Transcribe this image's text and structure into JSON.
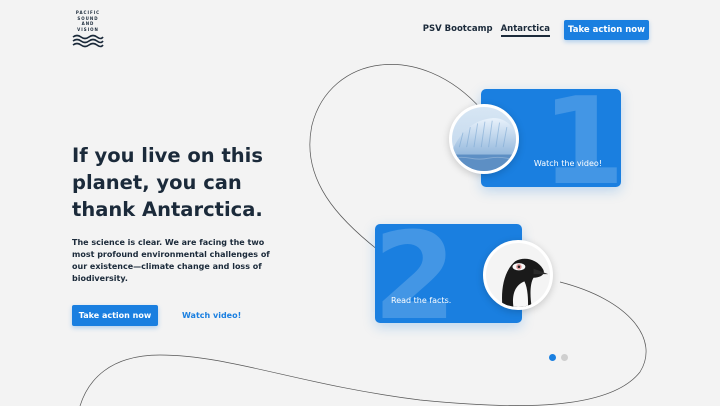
{
  "brand": {
    "logo_lines": [
      "PACIFIC",
      "SOUND",
      "AND",
      "VISION"
    ]
  },
  "nav": {
    "links": [
      {
        "label": "PSV Bootcamp",
        "active": false
      },
      {
        "label": "Antarctica",
        "active": true
      }
    ],
    "cta_label": "Take action now"
  },
  "hero": {
    "headline": "If you live on this planet, you can thank Antarctica.",
    "body": "The science is clear. We are facing the two most profound environmental challenges of our existence—climate change and loss of biodiversity.",
    "primary_button": "Take action now",
    "secondary_link": "Watch video!"
  },
  "cards": [
    {
      "number": "1",
      "label": "Watch the video!",
      "image": "iceberg"
    },
    {
      "number": "2",
      "label": "Read the facts.",
      "image": "penguin"
    }
  ],
  "pager": {
    "total": 2,
    "current": 1
  },
  "colors": {
    "accent": "#1a7fe0",
    "text": "#1b2a3a",
    "background": "#f3f3f3"
  }
}
